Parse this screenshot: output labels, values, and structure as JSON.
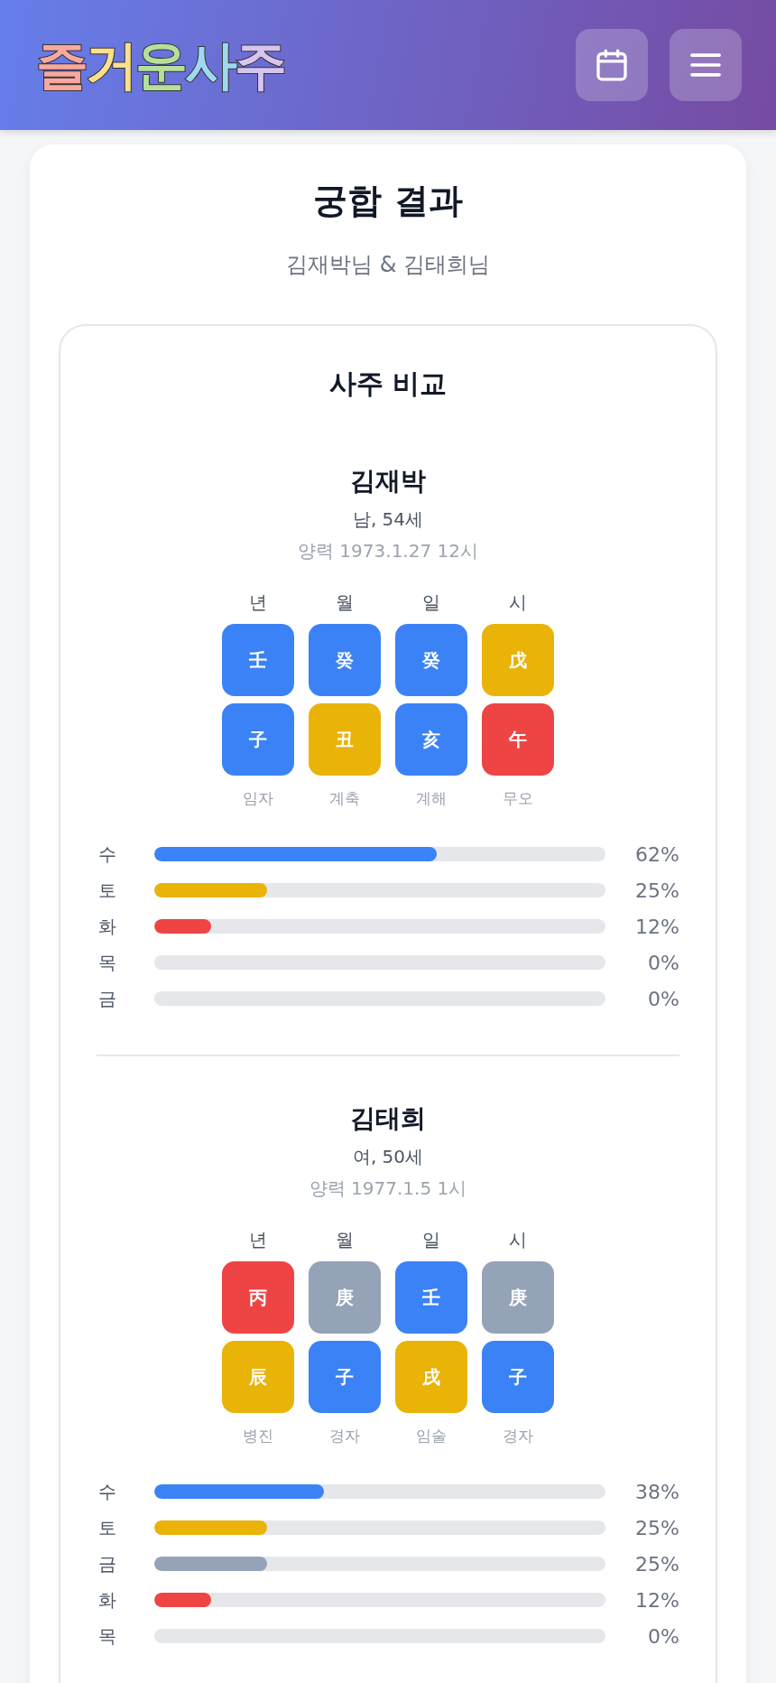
{
  "header": {
    "logo": "즐거운사주"
  },
  "title": "궁합 결과",
  "subtitle": "김재박님 & 김태희님",
  "comparison": {
    "title": "사주 비교",
    "people": [
      {
        "name": "김재박",
        "info": "남, 54세",
        "birth": "양력 1973.1.27 12시",
        "column_labels": [
          "년",
          "월",
          "일",
          "시"
        ],
        "stems": [
          {
            "char": "壬",
            "color": "#3b82f6"
          },
          {
            "char": "癸",
            "color": "#3b82f6"
          },
          {
            "char": "癸",
            "color": "#3b82f6"
          },
          {
            "char": "戊",
            "color": "#eab308"
          }
        ],
        "branches": [
          {
            "char": "子",
            "color": "#3b82f6"
          },
          {
            "char": "丑",
            "color": "#eab308"
          },
          {
            "char": "亥",
            "color": "#3b82f6"
          },
          {
            "char": "午",
            "color": "#ef4444"
          }
        ],
        "readings": [
          "임자",
          "계축",
          "계해",
          "무오"
        ],
        "elements": [
          {
            "label": "수",
            "color": "#3b82f6",
            "level": 0.625,
            "percent": "62%"
          },
          {
            "label": "토",
            "color": "#eab308",
            "level": 0.25,
            "percent": "25%"
          },
          {
            "label": "화",
            "color": "#ef4444",
            "level": 0.125,
            "percent": "12%"
          },
          {
            "label": "목",
            "percent": "0%"
          },
          {
            "label": "금",
            "percent": "0%"
          }
        ]
      },
      {
        "name": "김태희",
        "info": "여, 50세",
        "birth": "양력 1977.1.5 1시",
        "column_labels": [
          "년",
          "월",
          "일",
          "시"
        ],
        "stems": [
          {
            "char": "丙",
            "color": "#ef4444"
          },
          {
            "char": "庚",
            "color": "#94a3b8"
          },
          {
            "char": "壬",
            "color": "#3b82f6"
          },
          {
            "char": "庚",
            "color": "#94a3b8"
          }
        ],
        "branches": [
          {
            "char": "辰",
            "color": "#eab308"
          },
          {
            "char": "子",
            "color": "#3b82f6"
          },
          {
            "char": "戌",
            "color": "#eab308"
          },
          {
            "char": "子",
            "color": "#3b82f6"
          }
        ],
        "readings": [
          "병진",
          "경자",
          "임술",
          "경자"
        ],
        "elements": [
          {
            "label": "수",
            "color": "#3b82f6",
            "level": 0.375,
            "percent": "38%"
          },
          {
            "label": "토",
            "color": "#eab308",
            "level": 0.25,
            "percent": "25%"
          },
          {
            "label": "금",
            "color": "#94a3b8",
            "level": 0.25,
            "percent": "25%"
          },
          {
            "label": "화",
            "color": "#ef4444",
            "level": 0.125,
            "percent": "12%"
          },
          {
            "label": "목",
            "percent": "0%"
          }
        ]
      }
    ]
  }
}
